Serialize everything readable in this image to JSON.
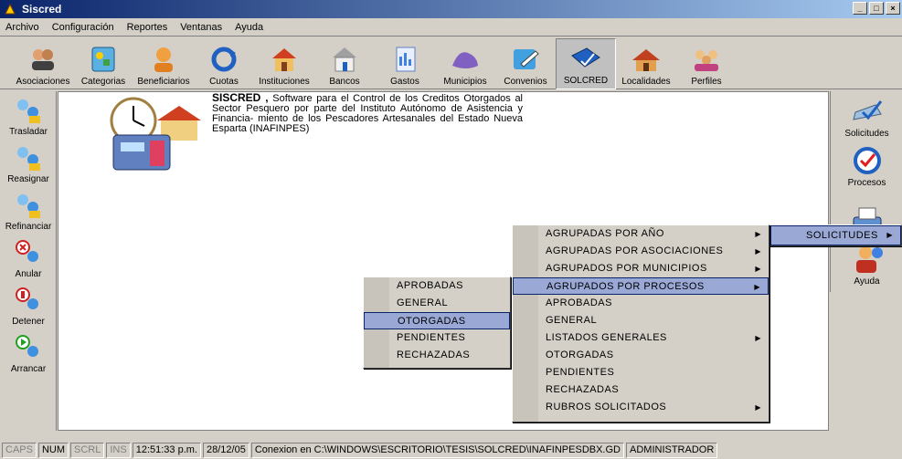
{
  "window": {
    "title": "Siscred",
    "controls": [
      "_",
      "□",
      "×"
    ]
  },
  "menubar": [
    "Archivo",
    "Configuración",
    "Reportes",
    "Ventanas",
    "Ayuda"
  ],
  "toolbar": [
    {
      "label": "Asociaciones",
      "icon": "people-icon"
    },
    {
      "label": "Categorias",
      "icon": "shapes-icon"
    },
    {
      "label": "Beneficiarios",
      "icon": "person-icon"
    },
    {
      "label": "Cuotas",
      "icon": "refresh-icon"
    },
    {
      "label": "Instituciones",
      "icon": "building-icon"
    },
    {
      "label": "Bancos",
      "icon": "bank-icon"
    },
    {
      "label": "Gastos",
      "icon": "document-icon"
    },
    {
      "label": "Municipios",
      "icon": "map-icon"
    },
    {
      "label": "Convenios",
      "icon": "pen-icon"
    },
    {
      "label": "SOLCRED",
      "icon": "credit-card-icon"
    },
    {
      "label": "Localidades",
      "icon": "house-icon"
    },
    {
      "label": "Perfiles",
      "icon": "profiles-icon"
    }
  ],
  "leftbar": [
    {
      "label": "Trasladar",
      "icon": "transfer-icon"
    },
    {
      "label": "Reasignar",
      "icon": "reassign-icon"
    },
    {
      "label": "Refinanciar",
      "icon": "refinance-icon"
    },
    {
      "label": "Anular",
      "icon": "cancel-icon"
    },
    {
      "label": "Detener",
      "icon": "stop-icon"
    },
    {
      "label": "Arrancar",
      "icon": "start-icon"
    }
  ],
  "rightbar": [
    {
      "label": "Solicitudes",
      "icon": "checklist-icon"
    },
    {
      "label": "Procesos",
      "icon": "clock-icon"
    },
    {
      "label": "",
      "icon": "printer-icon"
    },
    {
      "label": "Ayuda",
      "icon": "help-person-icon"
    }
  ],
  "about": {
    "title": "SISCRED ,",
    "body": " Software para el Control de los Creditos Otorgados al Sector Pesquero por parte del Instituto Autónomo de Asistencia y Financia- miento de los Pescadores Artesanales del Estado Nueva Esparta (INAFINPES)"
  },
  "menus": {
    "solicitudes": {
      "label": "SOLICITUDES"
    },
    "reportes": [
      {
        "label": "AGRUPADAS POR AÑO",
        "submenu": true
      },
      {
        "label": "AGRUPADAS POR ASOCIACIONES",
        "submenu": true
      },
      {
        "label": "AGRUPADOS POR MUNICIPIOS",
        "submenu": true
      },
      {
        "label": "AGRUPADOS POR PROCESOS",
        "submenu": true
      },
      {
        "label": "APROBADAS",
        "submenu": false
      },
      {
        "label": "GENERAL",
        "submenu": false
      },
      {
        "label": "LISTADOS GENERALES",
        "submenu": true
      },
      {
        "label": "OTORGADAS",
        "submenu": false
      },
      {
        "label": "PENDIENTES",
        "submenu": false
      },
      {
        "label": "RECHAZADAS",
        "submenu": false
      },
      {
        "label": "RUBROS SOLICITADOS",
        "submenu": true
      }
    ],
    "procesos": [
      {
        "label": "APROBADAS"
      },
      {
        "label": "GENERAL"
      },
      {
        "label": "OTORGADAS"
      },
      {
        "label": "PENDIENTES"
      },
      {
        "label": "RECHAZADAS"
      }
    ]
  },
  "status": {
    "caps": "CAPS",
    "num": "NUM",
    "scrl": "SCRL",
    "ins": "INS",
    "time": "12:51:33 p.m.",
    "date": "28/12/05",
    "connection": "Conexion en C:\\WINDOWS\\ESCRITORIO\\TESIS\\SOLCRED\\INAFINPESDBX.GD",
    "user": "ADMINISTRADOR"
  }
}
